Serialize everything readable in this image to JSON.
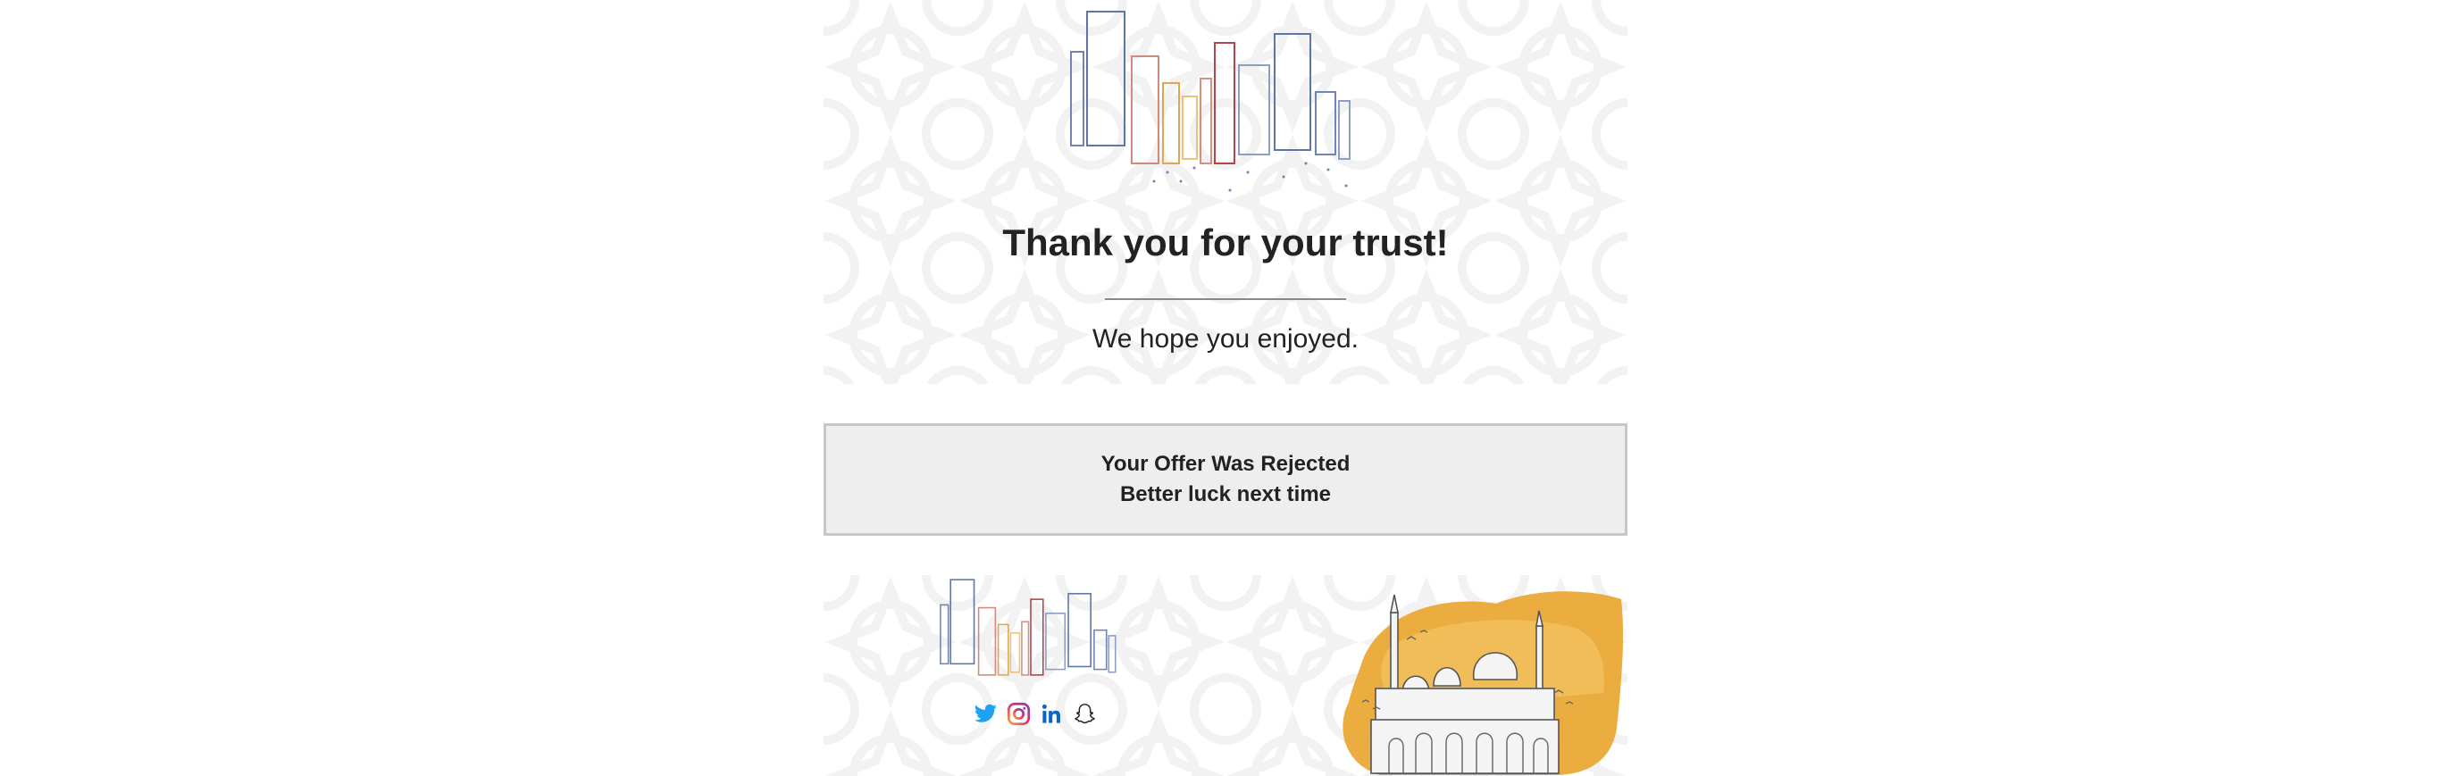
{
  "header": {
    "title": "Thank you for your trust!",
    "subtitle": "We hope you enjoyed."
  },
  "status": {
    "line1": "Your Offer Was Rejected",
    "line2": "Better luck next time"
  },
  "footer": {
    "social_icons": [
      "twitter-icon",
      "instagram-icon",
      "linkedin-icon",
      "snapchat-icon"
    ]
  },
  "colors": {
    "text": "#222222",
    "status_background": "#eeeeee",
    "status_border": "#c7c7c7",
    "divider": "#8a8a8a",
    "twitter": "#1da1f2",
    "linkedin": "#0a66c2",
    "mosque_wash": "#e9a42a"
  }
}
